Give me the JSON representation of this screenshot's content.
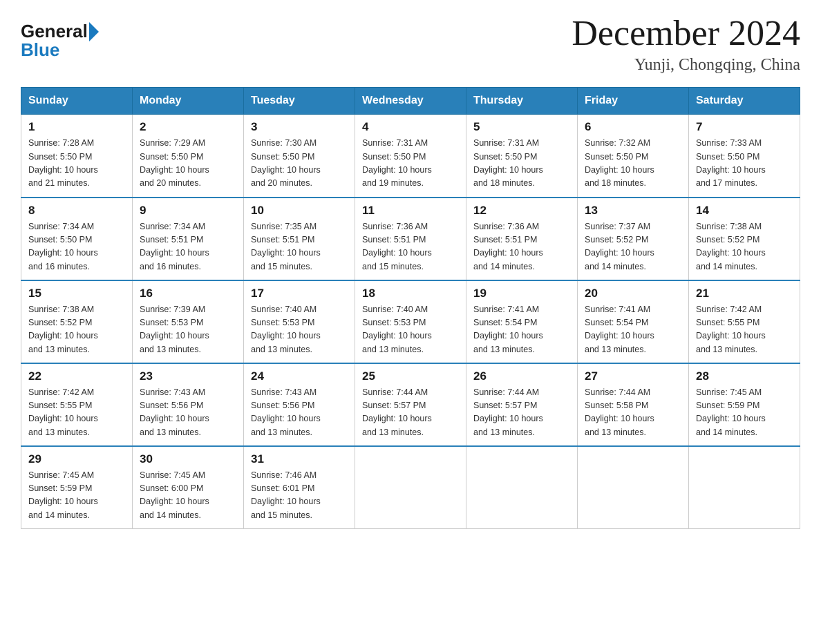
{
  "header": {
    "logo_general": "General",
    "logo_blue": "Blue",
    "month_year": "December 2024",
    "location": "Yunji, Chongqing, China"
  },
  "days_of_week": [
    "Sunday",
    "Monday",
    "Tuesday",
    "Wednesday",
    "Thursday",
    "Friday",
    "Saturday"
  ],
  "weeks": [
    [
      {
        "day": "1",
        "sunrise": "7:28 AM",
        "sunset": "5:50 PM",
        "daylight": "10 hours and 21 minutes."
      },
      {
        "day": "2",
        "sunrise": "7:29 AM",
        "sunset": "5:50 PM",
        "daylight": "10 hours and 20 minutes."
      },
      {
        "day": "3",
        "sunrise": "7:30 AM",
        "sunset": "5:50 PM",
        "daylight": "10 hours and 20 minutes."
      },
      {
        "day": "4",
        "sunrise": "7:31 AM",
        "sunset": "5:50 PM",
        "daylight": "10 hours and 19 minutes."
      },
      {
        "day": "5",
        "sunrise": "7:31 AM",
        "sunset": "5:50 PM",
        "daylight": "10 hours and 18 minutes."
      },
      {
        "day": "6",
        "sunrise": "7:32 AM",
        "sunset": "5:50 PM",
        "daylight": "10 hours and 18 minutes."
      },
      {
        "day": "7",
        "sunrise": "7:33 AM",
        "sunset": "5:50 PM",
        "daylight": "10 hours and 17 minutes."
      }
    ],
    [
      {
        "day": "8",
        "sunrise": "7:34 AM",
        "sunset": "5:50 PM",
        "daylight": "10 hours and 16 minutes."
      },
      {
        "day": "9",
        "sunrise": "7:34 AM",
        "sunset": "5:51 PM",
        "daylight": "10 hours and 16 minutes."
      },
      {
        "day": "10",
        "sunrise": "7:35 AM",
        "sunset": "5:51 PM",
        "daylight": "10 hours and 15 minutes."
      },
      {
        "day": "11",
        "sunrise": "7:36 AM",
        "sunset": "5:51 PM",
        "daylight": "10 hours and 15 minutes."
      },
      {
        "day": "12",
        "sunrise": "7:36 AM",
        "sunset": "5:51 PM",
        "daylight": "10 hours and 14 minutes."
      },
      {
        "day": "13",
        "sunrise": "7:37 AM",
        "sunset": "5:52 PM",
        "daylight": "10 hours and 14 minutes."
      },
      {
        "day": "14",
        "sunrise": "7:38 AM",
        "sunset": "5:52 PM",
        "daylight": "10 hours and 14 minutes."
      }
    ],
    [
      {
        "day": "15",
        "sunrise": "7:38 AM",
        "sunset": "5:52 PM",
        "daylight": "10 hours and 13 minutes."
      },
      {
        "day": "16",
        "sunrise": "7:39 AM",
        "sunset": "5:53 PM",
        "daylight": "10 hours and 13 minutes."
      },
      {
        "day": "17",
        "sunrise": "7:40 AM",
        "sunset": "5:53 PM",
        "daylight": "10 hours and 13 minutes."
      },
      {
        "day": "18",
        "sunrise": "7:40 AM",
        "sunset": "5:53 PM",
        "daylight": "10 hours and 13 minutes."
      },
      {
        "day": "19",
        "sunrise": "7:41 AM",
        "sunset": "5:54 PM",
        "daylight": "10 hours and 13 minutes."
      },
      {
        "day": "20",
        "sunrise": "7:41 AM",
        "sunset": "5:54 PM",
        "daylight": "10 hours and 13 minutes."
      },
      {
        "day": "21",
        "sunrise": "7:42 AM",
        "sunset": "5:55 PM",
        "daylight": "10 hours and 13 minutes."
      }
    ],
    [
      {
        "day": "22",
        "sunrise": "7:42 AM",
        "sunset": "5:55 PM",
        "daylight": "10 hours and 13 minutes."
      },
      {
        "day": "23",
        "sunrise": "7:43 AM",
        "sunset": "5:56 PM",
        "daylight": "10 hours and 13 minutes."
      },
      {
        "day": "24",
        "sunrise": "7:43 AM",
        "sunset": "5:56 PM",
        "daylight": "10 hours and 13 minutes."
      },
      {
        "day": "25",
        "sunrise": "7:44 AM",
        "sunset": "5:57 PM",
        "daylight": "10 hours and 13 minutes."
      },
      {
        "day": "26",
        "sunrise": "7:44 AM",
        "sunset": "5:57 PM",
        "daylight": "10 hours and 13 minutes."
      },
      {
        "day": "27",
        "sunrise": "7:44 AM",
        "sunset": "5:58 PM",
        "daylight": "10 hours and 13 minutes."
      },
      {
        "day": "28",
        "sunrise": "7:45 AM",
        "sunset": "5:59 PM",
        "daylight": "10 hours and 14 minutes."
      }
    ],
    [
      {
        "day": "29",
        "sunrise": "7:45 AM",
        "sunset": "5:59 PM",
        "daylight": "10 hours and 14 minutes."
      },
      {
        "day": "30",
        "sunrise": "7:45 AM",
        "sunset": "6:00 PM",
        "daylight": "10 hours and 14 minutes."
      },
      {
        "day": "31",
        "sunrise": "7:46 AM",
        "sunset": "6:01 PM",
        "daylight": "10 hours and 15 minutes."
      },
      null,
      null,
      null,
      null
    ]
  ],
  "labels": {
    "sunrise": "Sunrise:",
    "sunset": "Sunset:",
    "daylight": "Daylight:"
  }
}
